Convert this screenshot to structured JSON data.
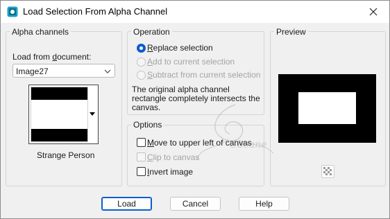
{
  "window": {
    "title": "Load Selection From Alpha Channel",
    "app_icon": "psp-icon",
    "close_icon": "close-icon"
  },
  "alpha_channels": {
    "group_label": "Alpha channels",
    "load_from_prefix": "Load from ",
    "load_from_underlined": "d",
    "load_from_suffix": "ocument:",
    "document_value": "Image27",
    "channel_name": "Strange Person"
  },
  "operation": {
    "group_label": "Operation",
    "options": [
      {
        "underline": "R",
        "rest": "eplace selection",
        "selected": true,
        "enabled": true
      },
      {
        "underline": "A",
        "rest": "dd to current selection",
        "selected": false,
        "enabled": false
      },
      {
        "underline": "S",
        "rest": "ubtract from current selection",
        "selected": false,
        "enabled": false
      }
    ],
    "info_text_line1": "The original alpha channel",
    "info_text_line2": "rectangle completely intersects the",
    "info_text_line3": "canvas."
  },
  "options": {
    "group_label": "Options",
    "items": [
      {
        "underline": "M",
        "rest": "ove to upper left of canvas",
        "checked": false,
        "enabled": true
      },
      {
        "underline": "C",
        "rest": "lip to canvas",
        "checked": false,
        "enabled": false
      },
      {
        "underline": "I",
        "rest": "nvert image",
        "checked": false,
        "enabled": true
      }
    ]
  },
  "preview": {
    "group_label": "Preview",
    "transparency_icon": "checkerboard-icon"
  },
  "buttons": {
    "load": "Load",
    "cancel": "Cancel",
    "help": "Help"
  },
  "watermark": {
    "text": "Cbeane"
  },
  "colors": {
    "accent": "#0b5cd0",
    "dialog_bg": "#f0f0f0",
    "preview_bg": "#000000"
  }
}
